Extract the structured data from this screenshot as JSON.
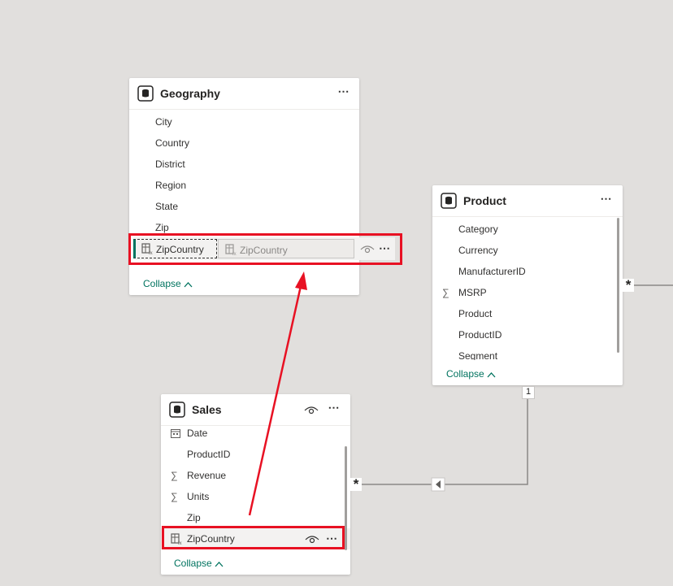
{
  "geography": {
    "title": "Geography",
    "fields": [
      "City",
      "Country",
      "District",
      "Region",
      "State",
      "Zip"
    ],
    "calc_field": "ZipCountry",
    "drag_ghost": "ZipCountry",
    "collapse": "Collapse"
  },
  "product": {
    "title": "Product",
    "fields": [
      "Category",
      "Currency",
      "ManufacturerID",
      "MSRP",
      "Product",
      "ProductID",
      "Segment"
    ],
    "collapse": "Collapse"
  },
  "sales": {
    "title": "Sales",
    "fields": [
      "Date",
      "ProductID",
      "Revenue",
      "Units",
      "Zip",
      "ZipCountry"
    ],
    "collapse": "Collapse"
  },
  "relationships": {
    "product_many": "*",
    "product_one": "1",
    "sales_many": "*"
  },
  "icons": {
    "more": "⋯",
    "sigma": "∑",
    "chevron": "^"
  },
  "colors": {
    "accent": "#00735f",
    "highlight": "#e81123",
    "canvas": "#e1dfdd"
  }
}
